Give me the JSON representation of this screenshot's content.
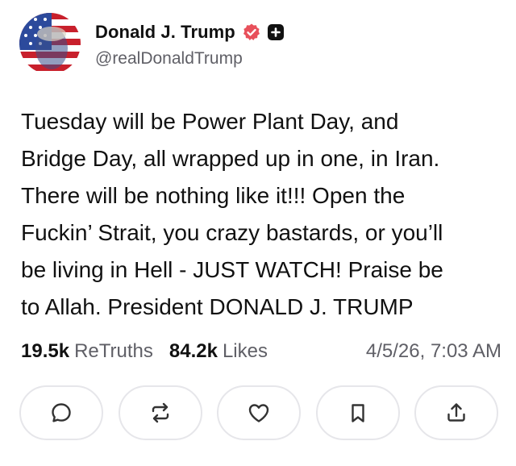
{
  "author": {
    "display_name": "Donald J. Trump",
    "handle": "@realDonaldTrump"
  },
  "post": {
    "text": "Tuesday will be Power Plant Day, and\nBridge Day, all wrapped up in one, in Iran.\nThere will be nothing like it!!! Open the\nFuckin’ Strait, you crazy bastards, or you’ll\nbe living in Hell - JUST WATCH! Praise be\nto Allah. President DONALD J. TRUMP",
    "retruths_count": "19.5k",
    "retruths_label": "ReTruths",
    "likes_count": "84.2k",
    "likes_label": "Likes",
    "timestamp": "4/5/26, 7:03 AM"
  },
  "actions": [
    {
      "name": "reply",
      "icon": "comment-icon"
    },
    {
      "name": "retruth",
      "icon": "repost-icon"
    },
    {
      "name": "like",
      "icon": "heart-icon"
    },
    {
      "name": "bookmark",
      "icon": "bookmark-icon"
    },
    {
      "name": "share",
      "icon": "share-icon"
    }
  ],
  "colors": {
    "verified_badge": "#e8505b",
    "text_primary": "#111111",
    "text_secondary": "#5f5f66",
    "button_border": "#e6e6ea"
  }
}
